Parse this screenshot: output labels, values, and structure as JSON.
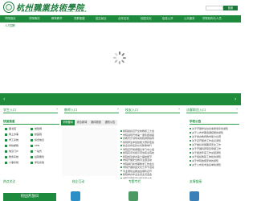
{
  "header": {
    "logo_cn": "杭州職業技術學院",
    "logo_en": "HANGZHOU VOCATIONAL & TECHNICAL COLLEGE",
    "search_placeholder": "",
    "search_button": "检索"
  },
  "nav": {
    "items": [
      "学院首页",
      "学院概况",
      "教育教学",
      "党群团建",
      "招生就业",
      "合作交流",
      "校园文化",
      "信息公开",
      "公共服务",
      "学院机构与人员",
      "人才招聘"
    ]
  },
  "subbar": {
    "item": "专栏"
  },
  "entries": [
    "学生入口",
    "教师入口",
    "校友入口",
    "访客职员入口"
  ],
  "quick_links": {
    "title": "快速通道",
    "items": [
      "图书馆",
      "党建网",
      "网上办事",
      "校医院",
      "学工系统",
      "综合信息",
      "学校邮箱",
      "VPN",
      "信息门户",
      "一站式",
      "教务系统",
      "后勤服务",
      "人事系统",
      "学位系统"
    ]
  },
  "middle": {
    "tabs": [
      "学院要闻",
      "综合新闻",
      "媒体报道",
      "通知公告"
    ],
    "news": [
      "我院组织召开全校教职工大会",
      "学院领导开学第一课专题讲座",
      "省教育厅领导来我院调研指导",
      "我院师生参加技能大赛获佳绩",
      "校企合作签约仪式隆重举行",
      "学院召开党委理论学习中心组",
      "我院获评省级示范性职业院校",
      "我院成功举办第十届技能节",
      "学院开展安全教育主题活动",
      "学院举行新学期教学工作会议",
      "学院开展校园文化艺术节活动",
      "专业群建设推进会顺利召开",
      "我院举办毕业生就业双选会",
      "学院召开年度总结表彰大会"
    ]
  },
  "right": {
    "title": "学校公告",
    "items": [
      "关于开展学生综合素质测评的通知",
      "关于公布学期选课结果的通知",
      "关于举办教师教学能力比赛",
      "关于召开团委工作会议通知",
      "关于做好寒假期间安全工作",
      "关于开展科研项目申报工作",
      "关于报送年度工作总结通知",
      "关于组织教职工体检的通知",
      "关于学院放假安排的通知",
      "关于公布奖学金名单的通知"
    ]
  },
  "footer": {
    "col1_title": "热点关注",
    "col2_title": "校企互动",
    "col3_title": "专题专栏",
    "col4_title": "友情链接",
    "button": "校园开放日"
  },
  "colors": {
    "primary": "#1d8a3e",
    "banner_bar": "#1e8b3b"
  }
}
